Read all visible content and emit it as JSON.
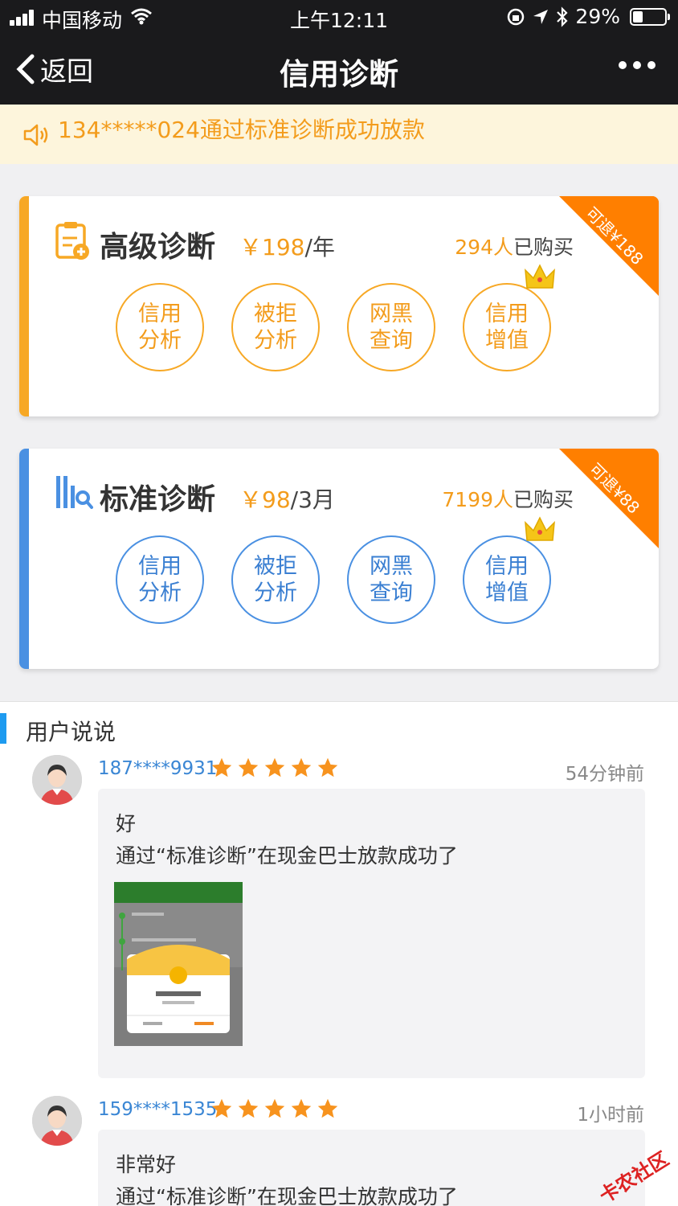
{
  "status": {
    "carrier": "中国移动",
    "time": "上午12:11",
    "battery": "29%"
  },
  "nav": {
    "back_label": "返回",
    "title": "信用诊断"
  },
  "notice": {
    "text": "134*****024通过标准诊断成功放款"
  },
  "colors": {
    "orange": "#f7a825",
    "blue": "#4a90e2",
    "nav_bg": "#1a1a1c",
    "notice_bg": "#fdf5dc",
    "corner": "#ff7f00"
  },
  "cards": [
    {
      "title": "高级诊断",
      "price_amount": "￥198",
      "price_unit": "/年",
      "buyers_count": "294人",
      "buyers_suffix": "已购买",
      "corner_label": "可退¥188",
      "icon": "clipboard-plus-icon",
      "features": [
        {
          "line1": "信用",
          "line2": "分析"
        },
        {
          "line1": "被拒",
          "line2": "分析"
        },
        {
          "line1": "网黑",
          "line2": "查询"
        },
        {
          "line1": "信用",
          "line2": "增值",
          "crown": true
        }
      ]
    },
    {
      "title": "标准诊断",
      "price_amount": "￥98",
      "price_unit": "/3月",
      "buyers_count": "7199人",
      "buyers_suffix": "已购买",
      "corner_label": "可退¥88",
      "icon": "bars-search-icon",
      "features": [
        {
          "line1": "信用",
          "line2": "分析"
        },
        {
          "line1": "被拒",
          "line2": "分析"
        },
        {
          "line1": "网黑",
          "line2": "查询"
        },
        {
          "line1": "信用",
          "line2": "增值",
          "crown": true
        }
      ]
    }
  ],
  "reviews_section": {
    "title": "用户说说",
    "items": [
      {
        "user": "187****9931",
        "stars": 5,
        "time": "54分钟前",
        "line1": "好",
        "line2": "通过“标准诊断”在现金巴士放款成功了",
        "has_image": true
      },
      {
        "user": "159****1535",
        "stars": 5,
        "time": "1小时前",
        "line1": "非常好",
        "line2": "通过“标准诊断”在现金巴士放款成功了",
        "has_image": false
      }
    ]
  },
  "watermark": "卡农社区"
}
